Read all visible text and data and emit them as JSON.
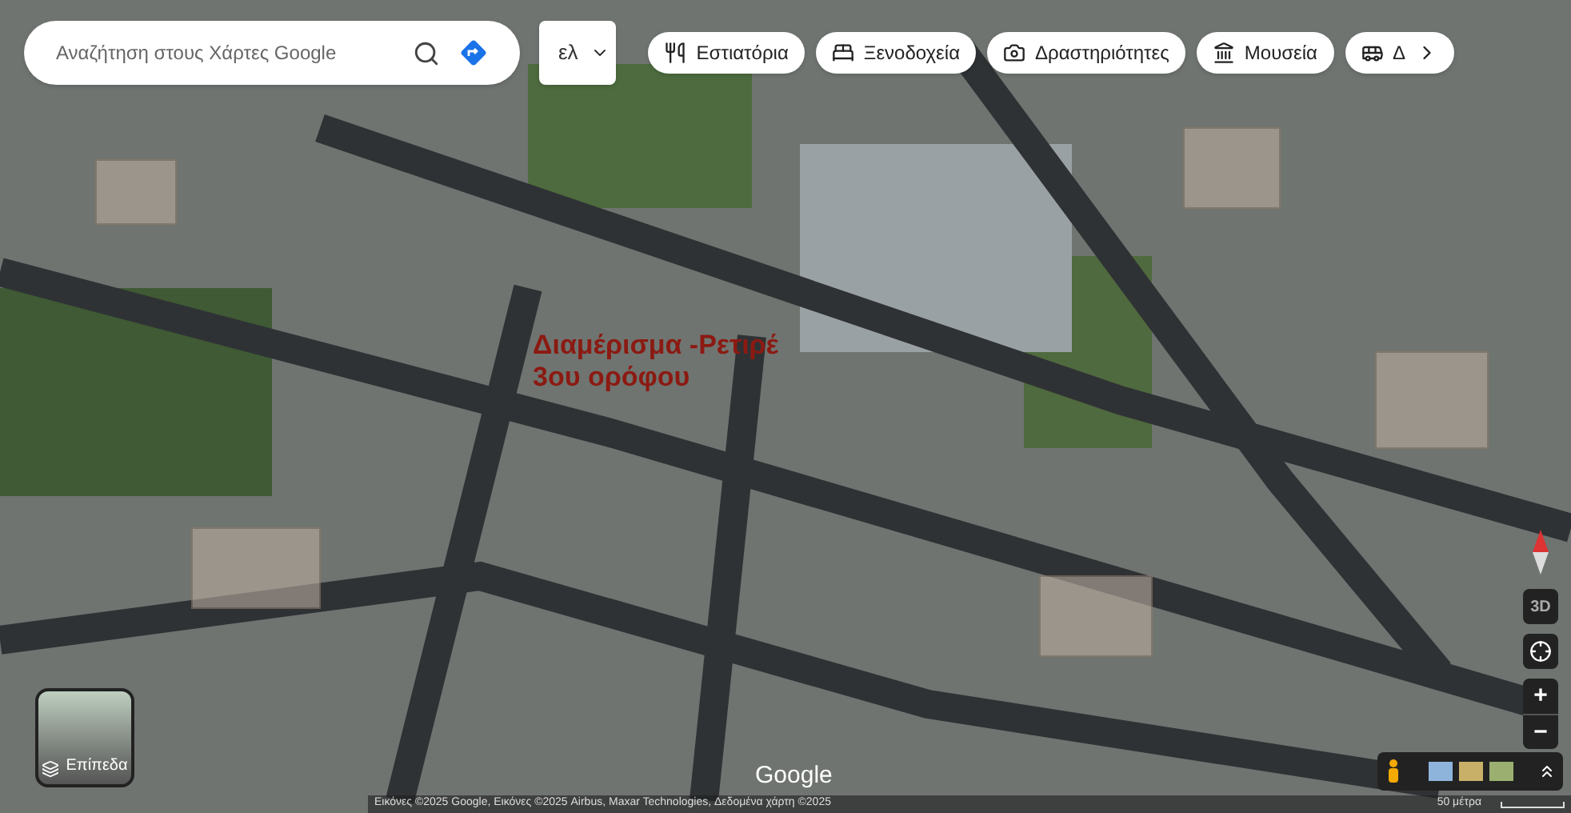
{
  "search": {
    "placeholder": "Αναζήτηση στους Χάρτες Google"
  },
  "language": {
    "label": "ελ"
  },
  "chips": [
    {
      "kind": "food",
      "label": "Εστιατόρια"
    },
    {
      "kind": "hotel",
      "label": "Ξενοδοχεία"
    },
    {
      "kind": "camera",
      "label": "Δραστηριότητες"
    },
    {
      "kind": "museum",
      "label": "Μουσεία"
    },
    {
      "kind": "transit",
      "label": "Δ"
    }
  ],
  "annotation": {
    "lines": [
      "Διαμέρισμα -Ρετιρέ",
      "3ου ορόφου"
    ]
  },
  "layers": {
    "label": "Επίπεδα"
  },
  "map_controls": {
    "tilt": "3D",
    "zoom_in": "+",
    "zoom_out": "−"
  },
  "logo": "Google",
  "attribution": "Εικόνες ©2025 Google, Εικόνες ©2025 Airbus, Maxar Technologies, Δεδομένα χάρτη ©2025",
  "scale": "50 μέτρα"
}
